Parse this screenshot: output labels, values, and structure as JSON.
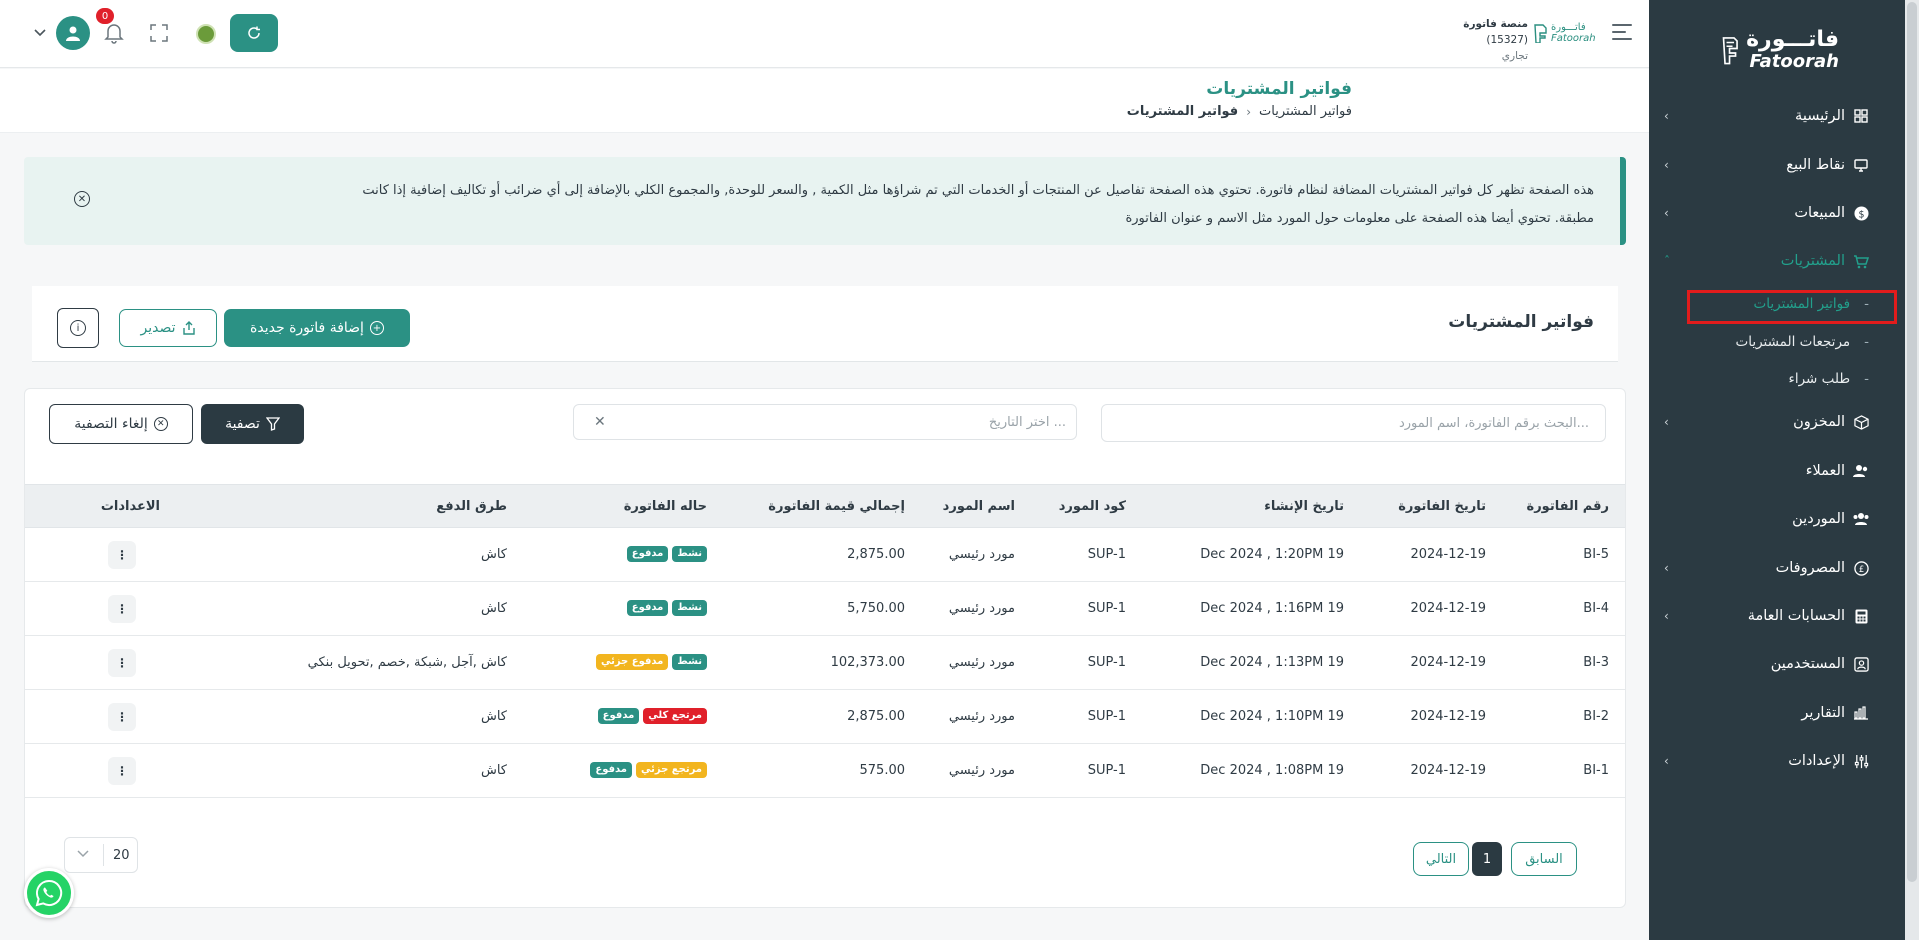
{
  "sidebar": {
    "logo": {
      "ar": "فاتـــورة",
      "en": "Fatoorah"
    },
    "items": [
      {
        "label": "الرئيسية",
        "icon": "grid-icon",
        "chevron": true
      },
      {
        "label": "نقاط البيع",
        "icon": "monitor-icon",
        "chevron": true
      },
      {
        "label": "المبيعات",
        "icon": "dollar-icon",
        "chevron": true
      },
      {
        "label": "المشتريات",
        "icon": "cart-icon",
        "chevron": true,
        "active": true
      },
      {
        "label": "المخزون",
        "icon": "box-icon",
        "chevron": true
      },
      {
        "label": "العملاء",
        "icon": "users-icon",
        "chevron": false
      },
      {
        "label": "الموردين",
        "icon": "suppliers-icon",
        "chevron": false
      },
      {
        "label": "المصروفات",
        "icon": "currency-icon",
        "chevron": true
      },
      {
        "label": "الحسابات العامة",
        "icon": "calculator-icon",
        "chevron": true
      },
      {
        "label": "المستخدمين",
        "icon": "user-card-icon",
        "chevron": false
      },
      {
        "label": "التقارير",
        "icon": "chart-icon",
        "chevron": false
      },
      {
        "label": "الإعدادات",
        "icon": "sliders-icon",
        "chevron": true
      }
    ],
    "subitems": [
      {
        "label": "فواتير المشتريات",
        "active": true
      },
      {
        "label": "مرتجعات المشتريات"
      },
      {
        "label": "طلب شراء"
      }
    ]
  },
  "topbar": {
    "company_name": "منصة فاتورة",
    "company_id": "(15327)",
    "company_type": "تجاري",
    "brand_small_ar": "فاتـــورة",
    "brand_small_en": "Fatoorah",
    "notifications_count": "0"
  },
  "page": {
    "title": "فواتير المشتريات",
    "breadcrumb": [
      "فواتير المشتريات",
      "فواتير المشتريات"
    ]
  },
  "info": {
    "text": "هذه الصفحة تظهر كل فواتير المشتريات المضافة لنظام فاتورة. تحتوي هذه الصفحة تفاصيل عن المنتجات أو الخدمات التي تم شراؤها مثل الكمية , والسعر للوحدة, والمجموع الكلي بالإضافة إلى أي ضرائب أو تكاليف إضافية إذا كانت مطبقة. تحتوي أيضا هذه الصفحة على معلومات حول المورد مثل الاسم و عنوان الفاتورة"
  },
  "card": {
    "title": "فواتير المشتريات",
    "add_label": "إضافة فاتورة جديدة",
    "export_label": "تصدير"
  },
  "filters": {
    "search_placeholder": "البحث برقم الفاتورة، اسم المورد...",
    "date_placeholder": "اختر التاريخ ...",
    "filter_label": "تصفية",
    "clear_label": "إلغاء التصفية"
  },
  "table": {
    "headers": {
      "number": "رقم الفاتورة",
      "date": "تاريخ الفاتورة",
      "created": "تاريخ الإنشاء",
      "supplier_code": "كود المورد",
      "supplier_name": "اسم المورد",
      "total": "إجمالي قيمة الفاتورة",
      "status": "حاله الفاتورة",
      "payment": "طرق الدفع",
      "settings": "الاعدادات"
    },
    "rows": [
      {
        "number": "BI-5",
        "date": "2024-12-19",
        "created": "19 Dec 2024 , 1:20PM",
        "supplier_code": "SUP-1",
        "supplier_name": "مورد رئيسي",
        "total": "2,875.00",
        "payment": "كاش",
        "tags": [
          {
            "label": "نشط",
            "color": "green"
          },
          {
            "label": "مدفوع",
            "color": "green"
          }
        ]
      },
      {
        "number": "BI-4",
        "date": "2024-12-19",
        "created": "19 Dec 2024 , 1:16PM",
        "supplier_code": "SUP-1",
        "supplier_name": "مورد رئيسي",
        "total": "5,750.00",
        "payment": "كاش",
        "tags": [
          {
            "label": "نشط",
            "color": "green"
          },
          {
            "label": "مدفوع",
            "color": "green"
          }
        ]
      },
      {
        "number": "BI-3",
        "date": "2024-12-19",
        "created": "19 Dec 2024 , 1:13PM",
        "supplier_code": "SUP-1",
        "supplier_name": "مورد رئيسي",
        "total": "102,373.00",
        "payment": "كاش ,آجل ,شبكة ,خصم ,تحويل بنكي",
        "tags": [
          {
            "label": "نشط",
            "color": "green"
          },
          {
            "label": "مدفوع جزئي",
            "color": "yellow"
          }
        ]
      },
      {
        "number": "BI-2",
        "date": "2024-12-19",
        "created": "19 Dec 2024 , 1:10PM",
        "supplier_code": "SUP-1",
        "supplier_name": "مورد رئيسي",
        "total": "2,875.00",
        "payment": "كاش",
        "tags": [
          {
            "label": "مرتجع كلي",
            "color": "red"
          },
          {
            "label": "مدفوع",
            "color": "green"
          }
        ]
      },
      {
        "number": "BI-1",
        "date": "2024-12-19",
        "created": "19 Dec 2024 , 1:08PM",
        "supplier_code": "SUP-1",
        "supplier_name": "مورد رئيسي",
        "total": "575.00",
        "payment": "كاش",
        "tags": [
          {
            "label": "مرتجع جزئي",
            "color": "yellow"
          },
          {
            "label": "مدفوع",
            "color": "green"
          }
        ]
      }
    ]
  },
  "pagination": {
    "prev_label": "السابق",
    "current_page": "1",
    "next_label": "التالي",
    "per_page": "20"
  },
  "colors": {
    "accent": "#2b9184",
    "sidebar": "#2b3a42",
    "danger": "#e0202a",
    "warning": "#f2b51f",
    "highlight_box": "#e21c1c"
  }
}
